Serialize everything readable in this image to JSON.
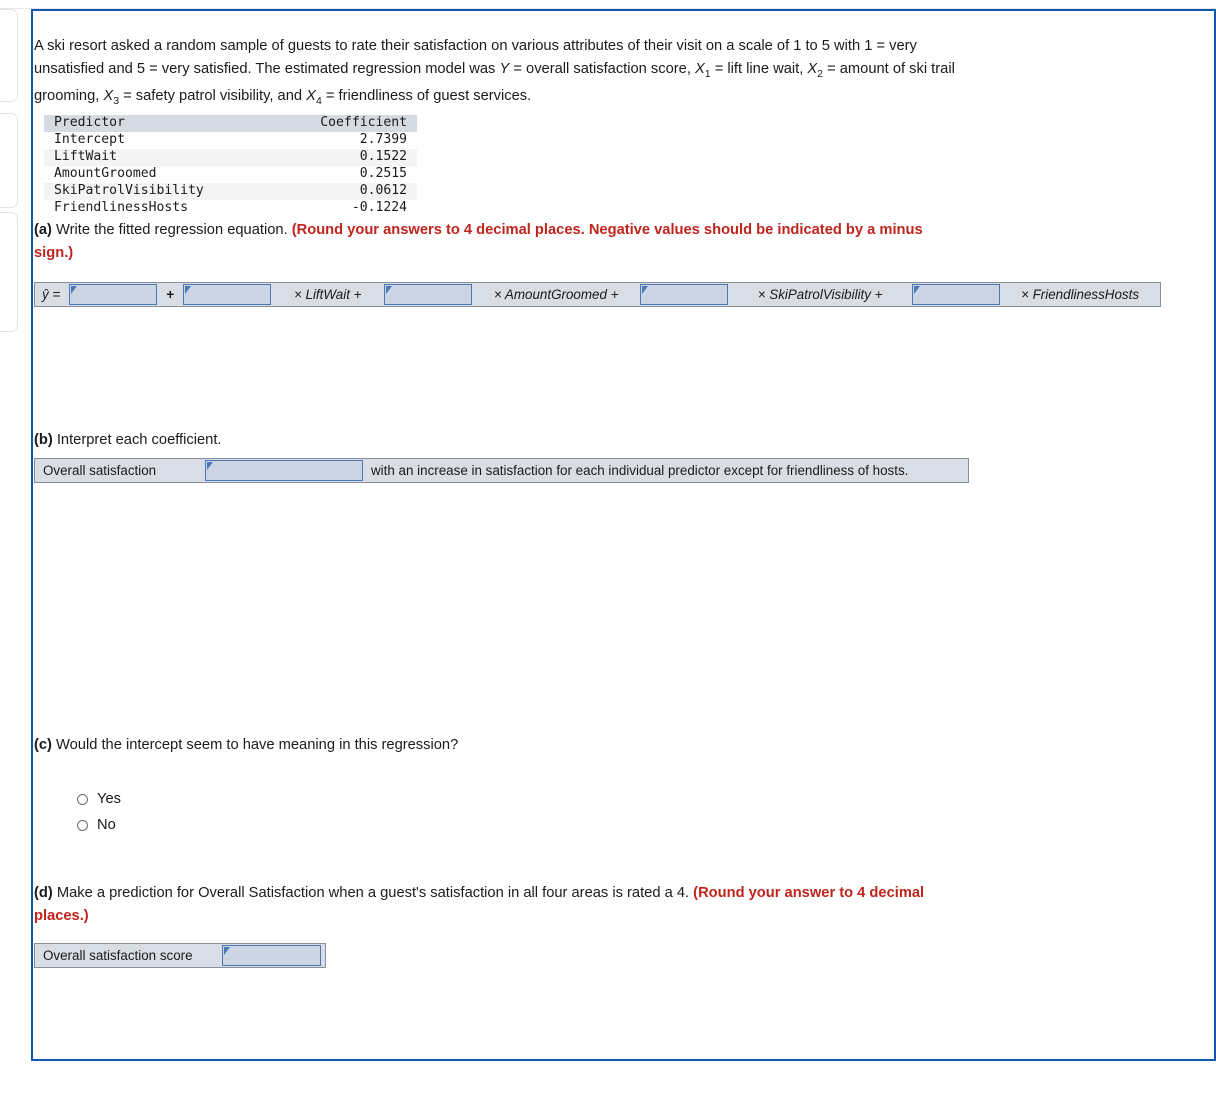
{
  "question": {
    "intro_line1_a": "A ski resort asked a random sample of guests to rate their satisfaction on various attributes of their visit on a scale of 1 to 5 with 1 = very unsatisfied and 5 = very satisfied. The estimated regression model was ",
    "intro_Y": "Y",
    "intro_Y_rest": " = overall satisfaction score, ",
    "intro_X1": "X",
    "intro_X1_sub": "1",
    "intro_X1_rest": " = lift line wait, ",
    "intro_X2": "X",
    "intro_X2_sub": "2",
    "intro_X2_rest": " = amount of ski trail grooming, ",
    "intro_X3": "X",
    "intro_X3_sub": "3",
    "intro_X3_rest": " = safety patrol visibility, and ",
    "intro_X4": "X",
    "intro_X4_sub": "4",
    "intro_X4_rest": " = friendliness of guest services."
  },
  "table": {
    "headers": [
      "Predictor",
      "Coefficient"
    ],
    "rows": [
      {
        "predictor": "Intercept",
        "coefficient": "2.7399"
      },
      {
        "predictor": "LiftWait",
        "coefficient": "0.1522"
      },
      {
        "predictor": "AmountGroomed",
        "coefficient": "0.2515"
      },
      {
        "predictor": "SkiPatrolVisibility",
        "coefficient": "0.0612"
      },
      {
        "predictor": "FriendlinessHosts",
        "coefficient": "-0.1224"
      }
    ]
  },
  "parts": {
    "a": {
      "label": "(a)",
      "text": " Write the fitted regression equation. ",
      "hint": "(Round your answers to 4 decimal places. Negative values should be indicated by a minus sign.)",
      "equation": {
        "lhs": "ŷ =",
        "op_plus": "+",
        "term1": "× LiftWait +",
        "term2": "× AmountGroomed +",
        "term3": "× SkiPatrolVisibility +",
        "term4": "× FriendlinessHosts",
        "input_values": [
          "",
          "",
          "",
          "",
          ""
        ],
        "input_placeholder": ""
      }
    },
    "b": {
      "label": "(b)",
      "text": " Interpret each coefficient.",
      "row_label": "Overall satisfaction",
      "dropdown_value": "",
      "trailing_text": "with an increase in satisfaction for each individual predictor except for friendliness of hosts."
    },
    "c": {
      "label": "(c)",
      "text": " Would the intercept seem to have meaning in this regression?",
      "options": [
        {
          "label": "Yes",
          "selected": false
        },
        {
          "label": "No",
          "selected": false
        }
      ]
    },
    "d": {
      "label": "(d)",
      "text": " Make a prediction for Overall Satisfaction when a guest's satisfaction in all four areas is rated a 4. ",
      "hint": "(Round your answer to 4 decimal places.)",
      "row_label": "Overall satisfaction score",
      "input_value": ""
    }
  },
  "colors": {
    "frame_border": "#1058ad",
    "hint_red": "#c0241c",
    "field_fill": "#ccd5e3",
    "field_border": "#4a78b4",
    "row_fill": "#d9dde6",
    "table_header": "#d6dae3"
  }
}
